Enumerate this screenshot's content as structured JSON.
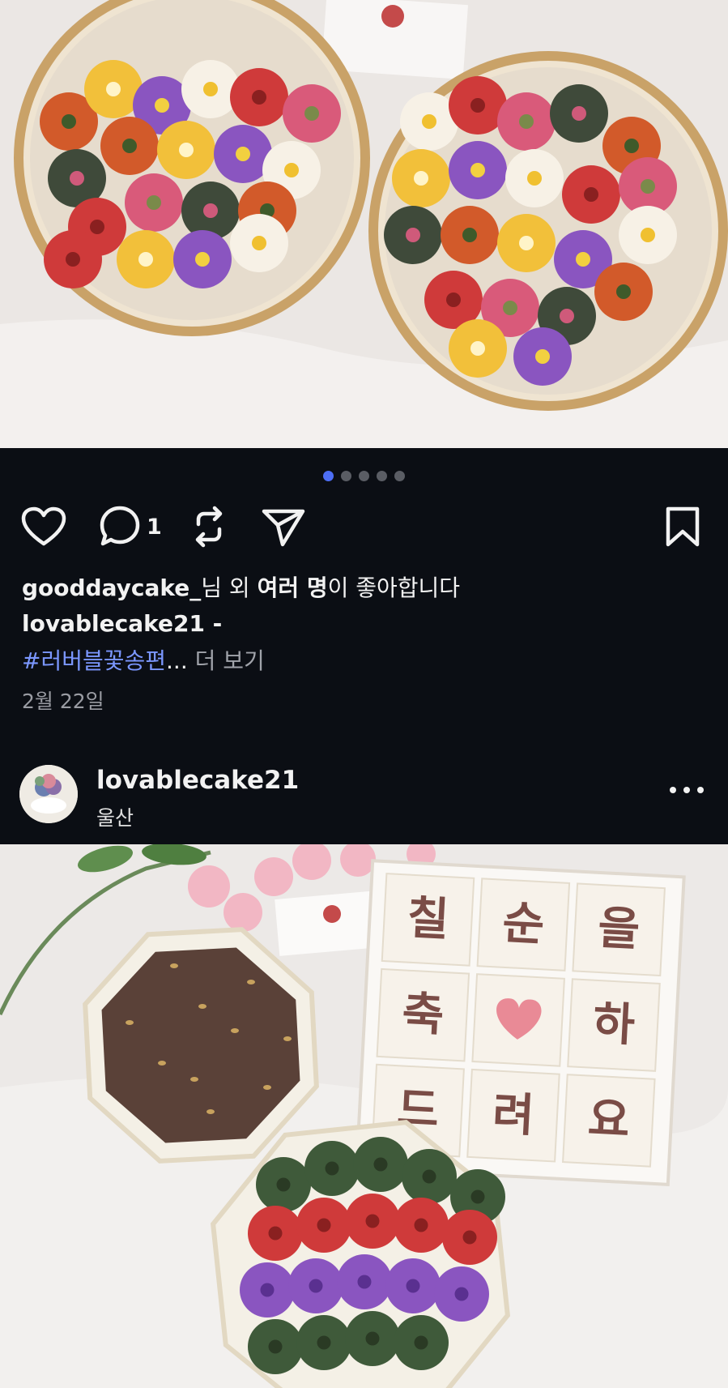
{
  "carousel": {
    "count": 5,
    "active_index": 0
  },
  "post1": {
    "comment_count": "1",
    "likes_user": "gooddaycake_",
    "likes_text_1": "님 외 ",
    "likes_text_bold": "여러 명",
    "likes_text_2": "이 좋아합니다",
    "caption_user": "lovablecake21 -",
    "caption_hashtag": "#러버블꽃송편",
    "caption_ellipsis": "...",
    "caption_more": " 더 보기",
    "date": "2월 22일"
  },
  "post2": {
    "username": "lovablecake21",
    "location": "울산",
    "box_text": [
      "칠",
      "순",
      "을",
      "축",
      "",
      "하",
      "드",
      "려",
      "요"
    ]
  },
  "colors": {
    "accent_dot": "#4d6ef5",
    "hashtag": "#7b97ff",
    "background": "#0b0e14"
  },
  "icons": [
    "heart-icon",
    "comment-icon",
    "repost-icon",
    "share-icon",
    "bookmark-icon",
    "more-icon"
  ]
}
